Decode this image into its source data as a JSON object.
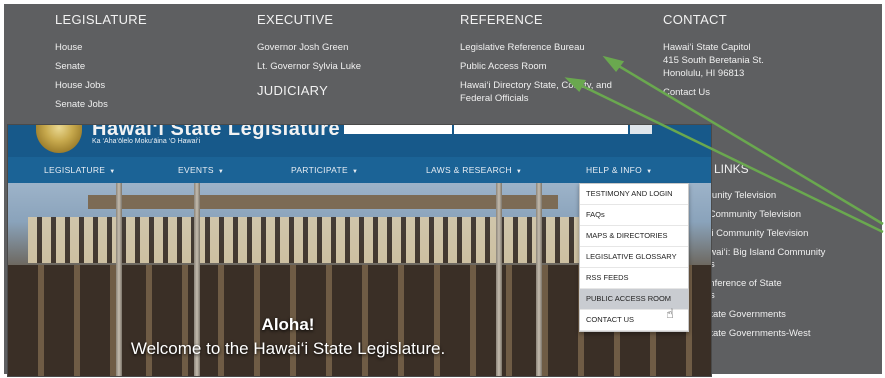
{
  "footer": {
    "legislature": {
      "heading": "LEGISLATURE",
      "links": [
        "House",
        "Senate",
        "House Jobs",
        "Senate Jobs"
      ]
    },
    "executive": {
      "heading": "EXECUTIVE",
      "links": [
        "Governor Josh Green",
        "Lt. Governor Sylvia Luke"
      ],
      "judiciary_heading": "JUDICIARY"
    },
    "reference": {
      "heading": "REFERENCE",
      "links": [
        "Legislative Reference Bureau",
        "Public Access Room",
        "Hawai‘i Directory State, County, and",
        "Federal Officials"
      ]
    },
    "contact": {
      "heading": "CONTACT",
      "address": [
        "Hawai‘i State Capitol",
        "415 South Beretania St.",
        "Honolulu, HI 96813"
      ],
      "contact_link": "Contact Us"
    },
    "links_section": {
      "heading": "LINKS",
      "links": [
        "munity Television",
        "i Community Television",
        "a‘i Community Television",
        "awai‘i: Big Island Community",
        "s",
        "onference of State",
        "s",
        "State Governments",
        "State Governments-West"
      ]
    }
  },
  "site": {
    "title": "Hawai‘i State Legislature",
    "subtitle": "Ka ‘Aha‘ōlelo Moku‘āina ‘O Hawai‘i",
    "nav": [
      "LEGISLATURE",
      "EVENTS",
      "PARTICIPATE",
      "LAWS & RESEARCH",
      "HELP & INFO"
    ],
    "dropdown": [
      "TESTIMONY AND LOGIN",
      "FAQs",
      "MAPS & DIRECTORIES",
      "LEGISLATIVE GLOSSARY",
      "RSS FEEDS",
      "PUBLIC ACCESS ROOM",
      "CONTACT US"
    ],
    "dropdown_active": "PUBLIC ACCESS ROOM",
    "hero_line1": "Aloha!",
    "hero_line2": "Welcome to the Hawai‘i State Legislature."
  },
  "colors": {
    "footer_bg": "#5e5f61",
    "nav_bg": "#1b6396",
    "arrow": "#6aa84f"
  }
}
